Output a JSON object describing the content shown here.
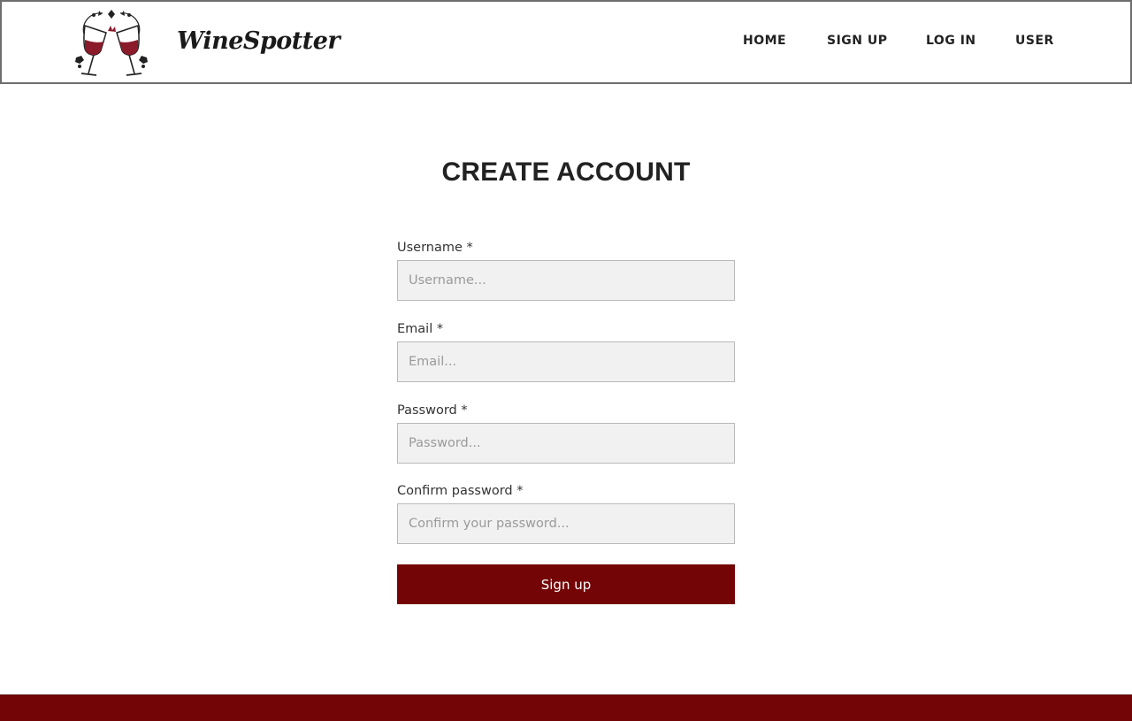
{
  "header": {
    "brand_name": "WineSpotter",
    "logo_icon": "wine-glasses-toast-icon",
    "nav": {
      "home": "HOME",
      "signup": "SIGN UP",
      "login": "LOG IN",
      "user": "USER"
    }
  },
  "main": {
    "title": "CREATE ACCOUNT",
    "form": {
      "username": {
        "label": "Username *",
        "placeholder": "Username...",
        "value": ""
      },
      "email": {
        "label": "Email *",
        "placeholder": "Email...",
        "value": ""
      },
      "password": {
        "label": "Password *",
        "placeholder": "Password...",
        "value": ""
      },
      "confirm_password": {
        "label": "Confirm password *",
        "placeholder": "Confirm your password...",
        "value": ""
      },
      "submit_label": "Sign up"
    }
  },
  "colors": {
    "accent": "#740507",
    "wine": "#8b1a2b",
    "input_bg": "#f1f1f1",
    "border": "#6e6e6e"
  }
}
